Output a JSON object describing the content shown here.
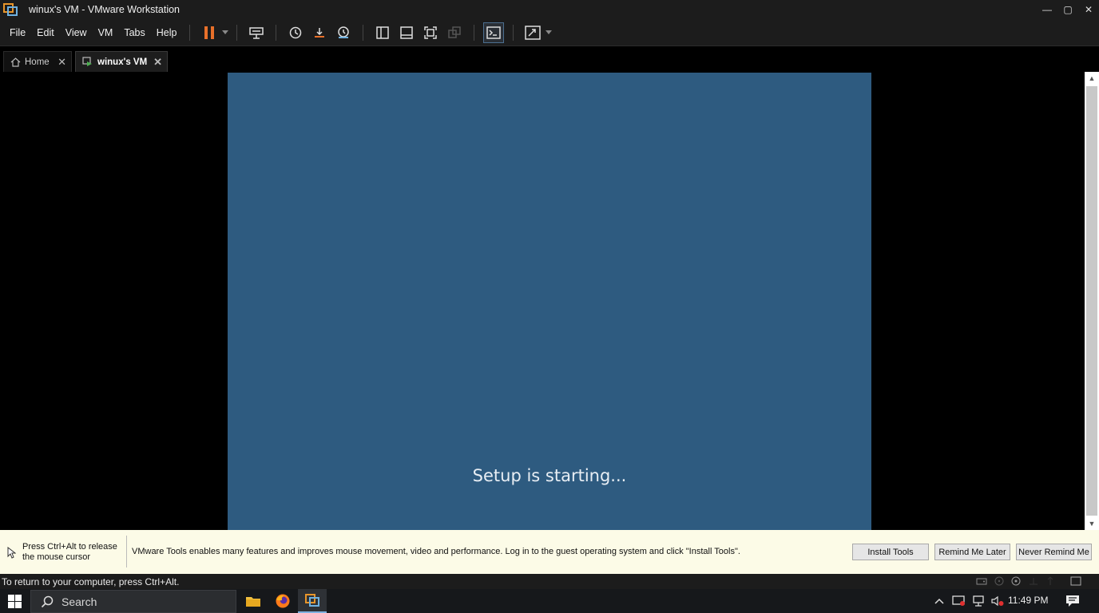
{
  "window": {
    "title": "winux's VM  - VMware Workstation",
    "controls": {
      "minimize": "—",
      "maximize": "▢",
      "close": "✕"
    }
  },
  "menu": [
    "File",
    "Edit",
    "View",
    "VM",
    "Tabs",
    "Help"
  ],
  "toolbar": {
    "icons": [
      "pause-icon",
      "send-ctrl-alt-del-icon",
      "snapshot-icon",
      "revert-snapshot-icon",
      "snapshot-manager-icon",
      "library-icon",
      "thumbnail-bar-icon",
      "full-screen-icon",
      "unity-icon",
      "console-view-icon",
      "stretch-guest-icon"
    ],
    "accent": "#e8702a"
  },
  "tabs": [
    {
      "label": "Home",
      "icon": "home-icon",
      "close": "✕"
    },
    {
      "label": "winux's VM",
      "icon": "vm-icon",
      "close": "✕"
    }
  ],
  "guest": {
    "text": "Setup is starting...",
    "background": "#2e5b80"
  },
  "notification": {
    "release_hint": "Press Ctrl+Alt to release the mouse cursor",
    "message": "VMware Tools enables many features and improves mouse movement, video and performance. Log in to the guest operating system and click \"Install Tools\".",
    "buttons": {
      "install": "Install Tools",
      "remind_later": "Remind Me Later",
      "never_remind": "Never Remind Me"
    }
  },
  "statusbar": {
    "text": "To return to your computer, press Ctrl+Alt."
  },
  "taskbar": {
    "search_placeholder": "Search",
    "apps": [
      "file-explorer-icon",
      "firefox-icon",
      "vmware-workstation-icon"
    ],
    "clock": "11:49 PM"
  }
}
